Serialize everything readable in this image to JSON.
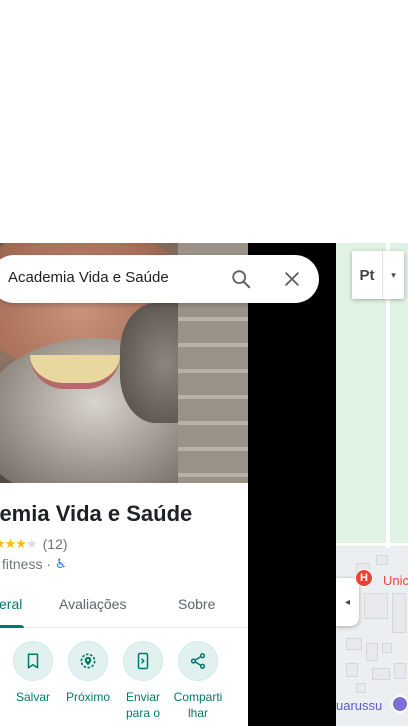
{
  "search": {
    "query": "Academia Vida e Saúde"
  },
  "place": {
    "title": "demia Vida e Saúde",
    "rating_stars": "★★★",
    "rating_stars_empty": "★",
    "review_count": "(12)",
    "category": "fitness",
    "category_separator": "·",
    "accessible_symbol": "♿"
  },
  "tabs": [
    {
      "label": "eral",
      "active": true
    },
    {
      "label": "Avaliações",
      "active": false
    },
    {
      "label": "Sobre",
      "active": false
    }
  ],
  "actions": [
    {
      "label": "Salvar",
      "icon": "bookmark-icon"
    },
    {
      "label": "Próximo",
      "icon": "nearby-icon"
    },
    {
      "label": "Enviar para o",
      "icon": "send-to-phone-icon"
    },
    {
      "label": "Comparti lhar",
      "icon": "share-icon"
    }
  ],
  "map": {
    "layer_button_label": "Pt",
    "layer_caret": "▾",
    "collapse_arrow": "◂",
    "hospital_marker": "H",
    "label_uni": "Unic",
    "label_guarussu": "uarussu"
  },
  "colors": {
    "accent": "#00796b",
    "action_bg": "#e1f1f0",
    "star": "#fbbc04",
    "map_bg": "#dff2e4",
    "hospital": "#ea4335"
  }
}
